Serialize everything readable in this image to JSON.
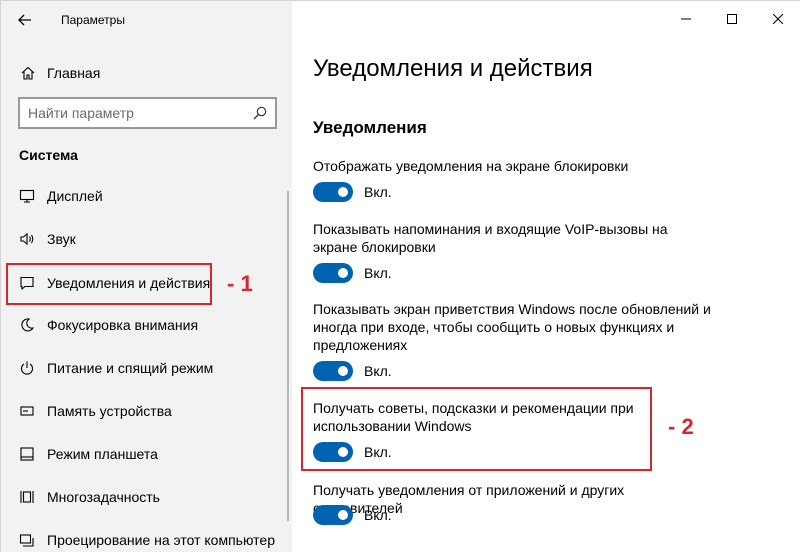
{
  "window": {
    "app_title": "Параметры"
  },
  "sidebar": {
    "home_label": "Главная",
    "search_placeholder": "Найти параметр",
    "section_title": "Система",
    "items": [
      {
        "label": "Дисплей",
        "icon": "monitor-icon"
      },
      {
        "label": "Звук",
        "icon": "speaker-icon"
      },
      {
        "label": "Уведомления и действия",
        "icon": "notification-icon",
        "selected": true
      },
      {
        "label": "Фокусировка внимания",
        "icon": "moon-icon"
      },
      {
        "label": "Питание и спящий режим",
        "icon": "power-icon"
      },
      {
        "label": "Память устройства",
        "icon": "storage-icon"
      },
      {
        "label": "Режим планшета",
        "icon": "tablet-icon"
      },
      {
        "label": "Многозадачность",
        "icon": "multitasking-icon"
      },
      {
        "label": "Проецирование на этот компьютер",
        "icon": "projecting-icon"
      }
    ]
  },
  "main": {
    "page_title": "Уведомления и действия",
    "section_title": "Уведомления",
    "settings": [
      {
        "label": "Отображать уведомления на экране блокировки",
        "state": "Вкл.",
        "on": true
      },
      {
        "label": "Показывать напоминания и входящие VoIP-вызовы на экране блокировки",
        "state": "Вкл.",
        "on": true
      },
      {
        "label": "Показывать экран приветствия Windows после обновлений и иногда при входе, чтобы сообщить о новых функциях и предложениях",
        "state": "Вкл.",
        "on": true
      },
      {
        "label": "Получать советы, подсказки и рекомендации при использовании Windows",
        "state": "Вкл.",
        "on": true
      },
      {
        "label": "Получать уведомления от приложений и других отправителей",
        "state": "Вкл.",
        "on": true
      }
    ]
  },
  "annotations": {
    "label_1": "- 1",
    "label_2": "- 2",
    "color": "#d9262c"
  },
  "colors": {
    "accent": "#0063b1",
    "sidebar_bg": "#f2f2f2"
  }
}
